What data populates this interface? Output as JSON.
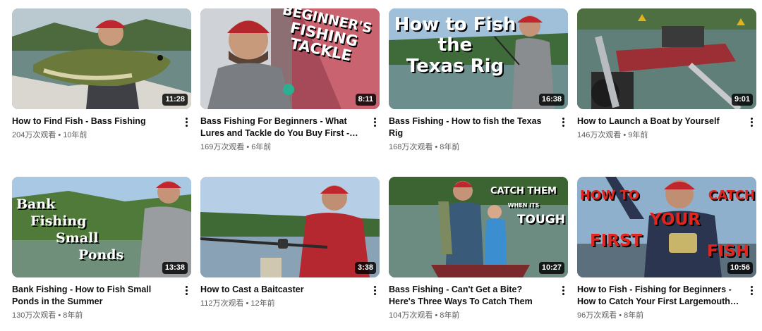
{
  "videos": [
    {
      "title": "How to Find Fish - Bass Fishing",
      "views": "204万次观看",
      "age": "10年前",
      "duration": "11:28",
      "overlay": []
    },
    {
      "title": "Bass Fishing For Beginners - What Lures and Tackle do You Buy First - How to Fish",
      "views": "169万次观看",
      "age": "6年前",
      "duration": "8:11",
      "overlay": [
        "BEGINNER'S",
        "FISHING",
        "TACKLE"
      ]
    },
    {
      "title": "Bass Fishing - How to fish the Texas Rig",
      "views": "168万次观看",
      "age": "8年前",
      "duration": "16:38",
      "overlay": [
        "How to Fish",
        "the",
        "Texas Rig"
      ]
    },
    {
      "title": "How to Launch a Boat by Yourself",
      "views": "146万次观看",
      "age": "9年前",
      "duration": "9:01",
      "overlay": []
    },
    {
      "title": "Bank Fishing - How to Fish Small Ponds in the Summer",
      "views": "130万次观看",
      "age": "8年前",
      "duration": "13:38",
      "overlay": [
        "Bank",
        "Fishing",
        "Small",
        "Ponds"
      ]
    },
    {
      "title": "How to Cast a Baitcaster",
      "views": "112万次观看",
      "age": "12年前",
      "duration": "3:38",
      "overlay": []
    },
    {
      "title": "Bass Fishing - Can't Get a Bite? Here's Three Ways To Catch Them",
      "views": "104万次观看",
      "age": "8年前",
      "duration": "10:27",
      "overlay": [
        "CATCH THEM",
        "WHEN ITS",
        "TOUGH"
      ]
    },
    {
      "title": "How to Fish - Fishing for Beginners - How to Catch Your First Largemouth Bass",
      "views": "96万次观看",
      "age": "8年前",
      "duration": "10:56",
      "overlay": [
        "HOW TO",
        "CATCH",
        "YOUR",
        "FIRST",
        "FISH"
      ]
    }
  ],
  "separator": "•",
  "icons": {
    "more": "more-vert-icon"
  }
}
